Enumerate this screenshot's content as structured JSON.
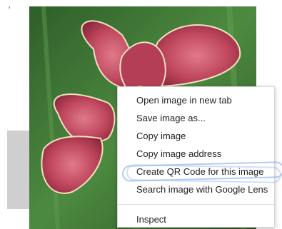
{
  "stray_mark": "'",
  "image": {
    "description_icon": "flower-photo"
  },
  "context_menu": {
    "items": [
      {
        "label": "Open image in new tab"
      },
      {
        "label": "Save image as..."
      },
      {
        "label": "Copy image"
      },
      {
        "label": "Copy image address"
      },
      {
        "label": "Create QR Code for this image"
      },
      {
        "label": "Search image with Google Lens"
      }
    ],
    "bottom_items": [
      {
        "label": "Inspect"
      }
    ]
  },
  "colors": {
    "petal": "#c0485e",
    "foliage": "#3f7a3a",
    "scribble": "#7aa0e6"
  }
}
